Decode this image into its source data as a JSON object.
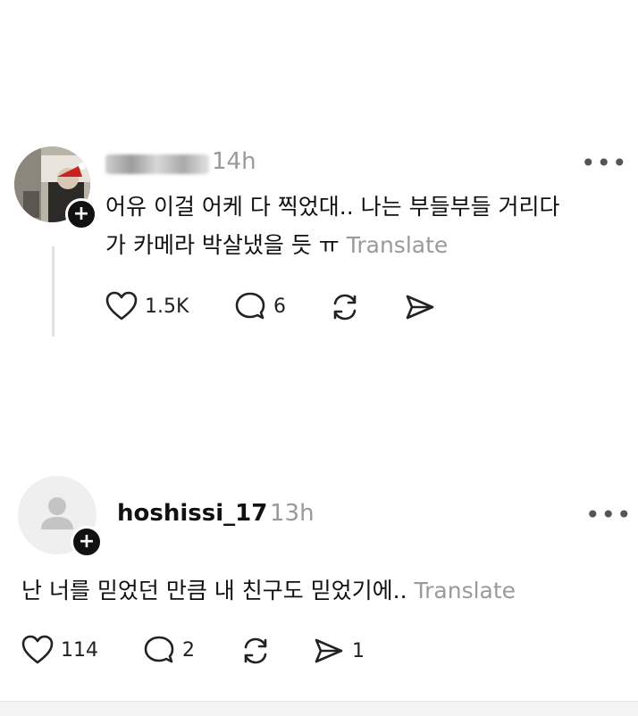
{
  "posts": [
    {
      "time": "14h",
      "text": "어유 이걸 어케 다 찍었대.. 나는 부들부들 거리다가 카메라 박살냈을 듯 ㅠ",
      "line1": "어유 이걸 어케 다 찍었대.. 나는 부들부들 거리다",
      "line2": "가 카메라 박살냈을 듯 ㅠ",
      "translate_label": "Translate",
      "more_label": "•••",
      "likes": "1.5K",
      "comments": "6",
      "reposts": "",
      "shares": ""
    },
    {
      "username": "hoshissi_17",
      "time": "13h",
      "text": "난 너를 믿었던 만큼 내 친구도 믿었기에..",
      "translate_label": "Translate",
      "more_label": "•••",
      "likes": "114",
      "comments": "2",
      "reposts": "",
      "shares": "1"
    }
  ],
  "icons": {
    "like": "heart-icon",
    "comment": "comment-bubble-icon",
    "repost": "repost-icon",
    "share": "send-icon",
    "follow": "plus-icon"
  },
  "colors": {
    "muted": "#9a9a9a",
    "text": "#111111",
    "badge": "#111111"
  }
}
